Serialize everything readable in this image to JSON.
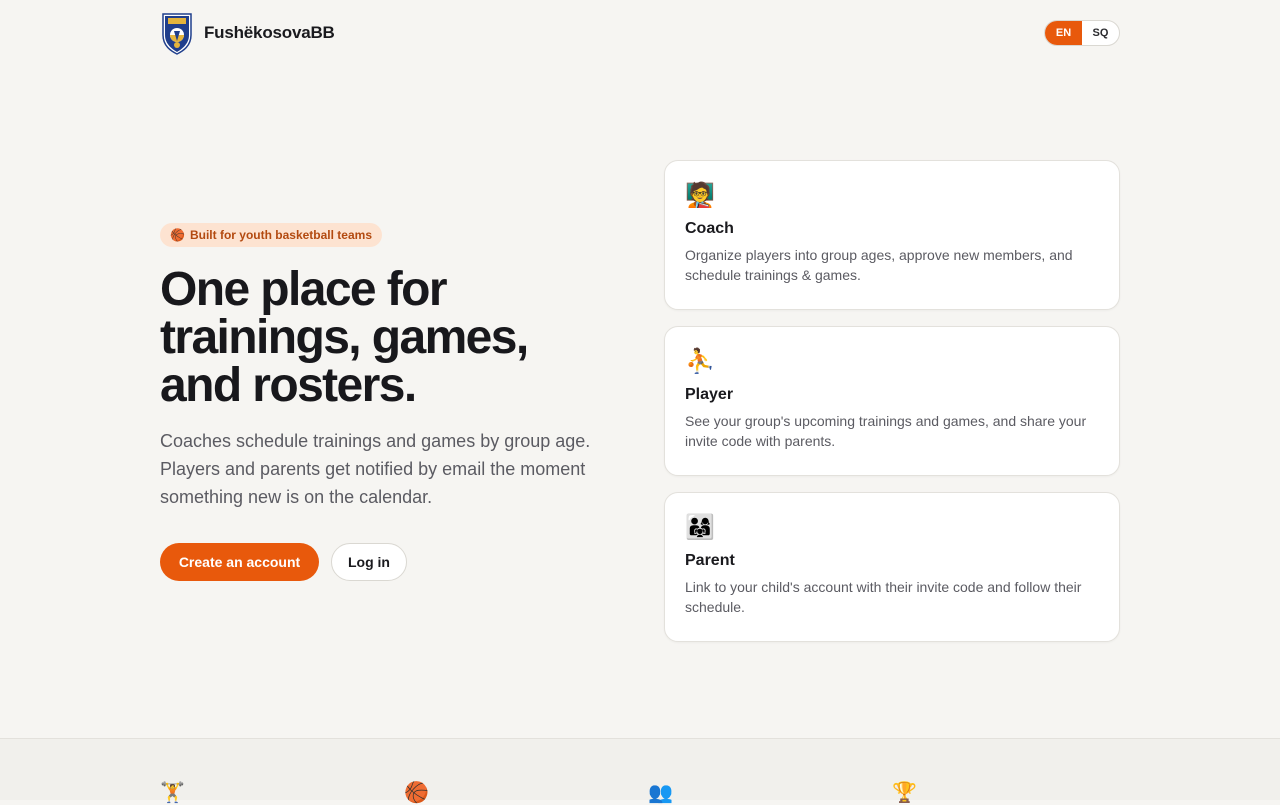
{
  "header": {
    "brand_name": "FushëkosovaBB",
    "languages": [
      {
        "code": "EN",
        "active": true
      },
      {
        "code": "SQ",
        "active": false
      }
    ]
  },
  "hero": {
    "pill_icon": "🏀",
    "pill_text": "Built for youth basketball teams",
    "title_line1": "One place for",
    "title_line2": "trainings, games,",
    "title_line3": "and rosters.",
    "subtitle": "Coaches schedule trainings and games by group age. Players and parents get notified by email the moment something new is on the calendar.",
    "cta_primary": "Create an account",
    "cta_secondary": "Log in"
  },
  "roles": [
    {
      "icon": "🧑‍🏫",
      "icon_name": "coach-icon",
      "title": "Coach",
      "description": "Organize players into group ages, approve new members, and schedule trainings & games."
    },
    {
      "icon": "⛹️",
      "icon_name": "player-icon",
      "title": "Player",
      "description": "See your group's upcoming trainings and games, and share your invite code with parents."
    },
    {
      "icon": "👨‍👩‍👧",
      "icon_name": "family-icon",
      "title": "Parent",
      "description": "Link to your child's account with their invite code and follow their schedule."
    }
  ],
  "features": [
    {
      "icon": "🏋️",
      "icon_name": "weightlifter-icon"
    },
    {
      "icon": "🏀",
      "icon_name": "basketball-icon"
    },
    {
      "icon": "👥",
      "icon_name": "people-icon"
    },
    {
      "icon": "🏆",
      "icon_name": "trophy-icon"
    }
  ],
  "colors": {
    "accent": "#e8590c",
    "background": "#f6f5f2",
    "pill_bg": "#fde3d1",
    "logo_navy": "#1f3e8c",
    "logo_gold": "#e4b43c"
  }
}
